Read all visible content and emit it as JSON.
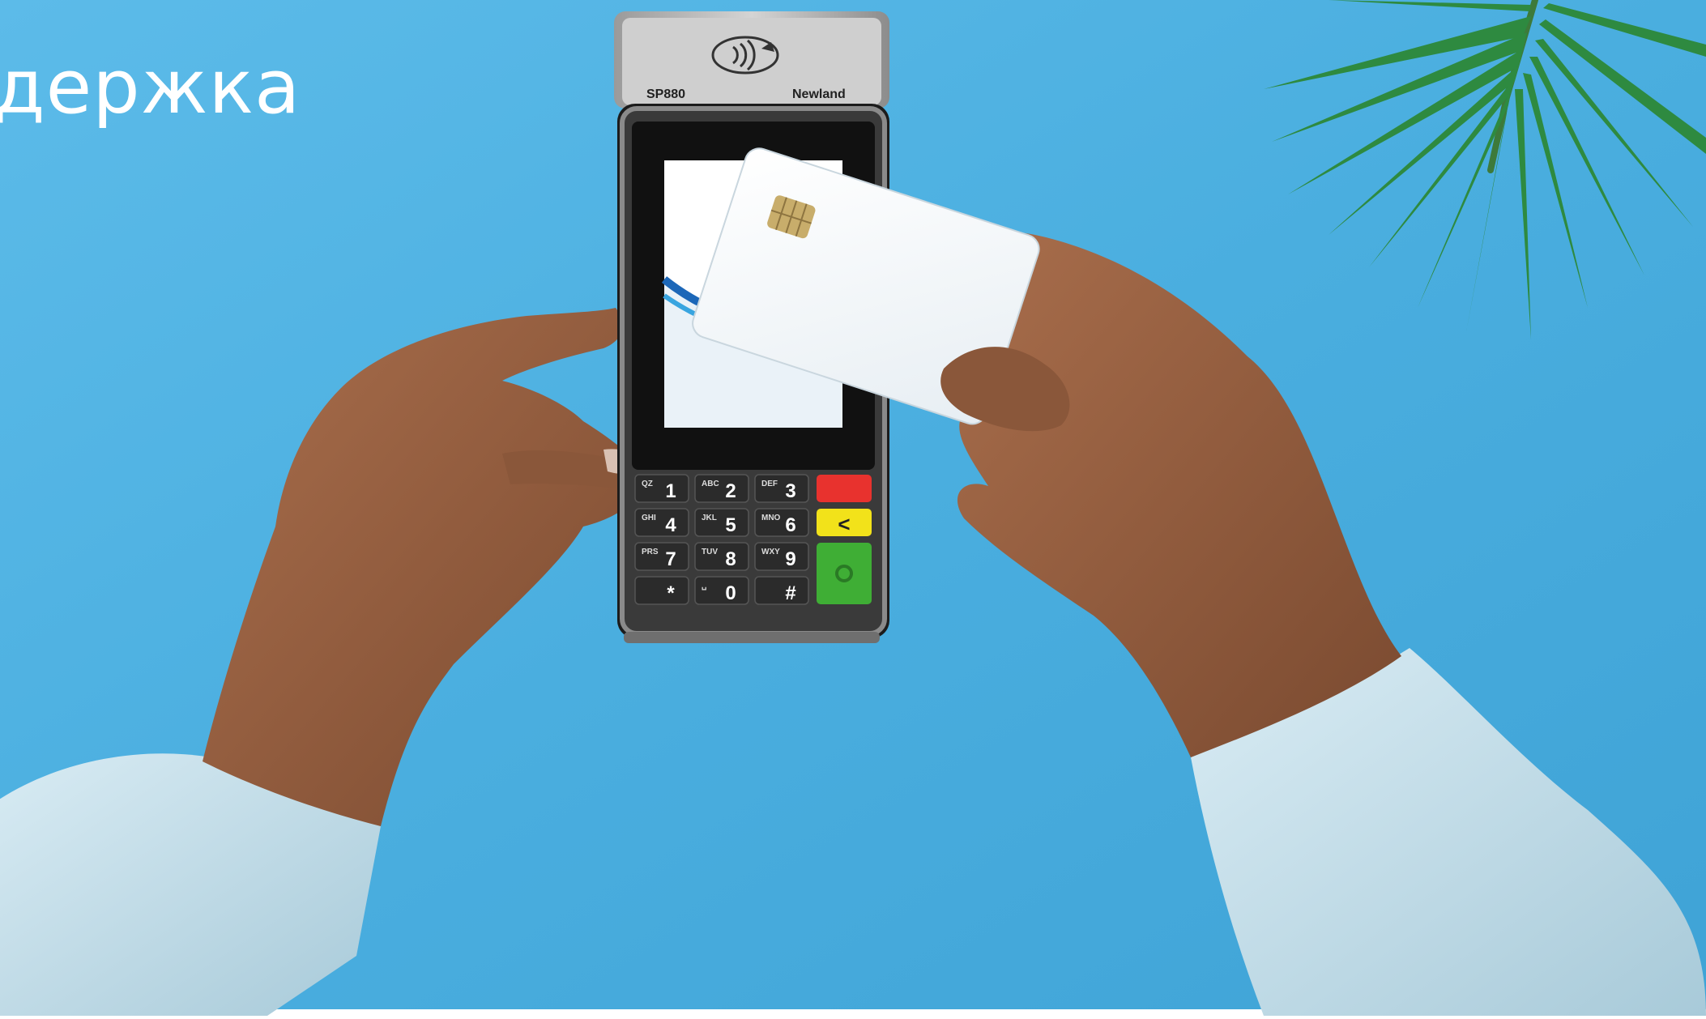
{
  "hero": {
    "title": "держка",
    "background_color": "#4fb0e0"
  },
  "terminal": {
    "model": "SP880",
    "brand": "Newland",
    "contactless_symbol": "contactless-payment-icon",
    "keys": [
      {
        "digit": "1",
        "letters": "QZ"
      },
      {
        "digit": "2",
        "letters": "ABC"
      },
      {
        "digit": "3",
        "letters": "DEF"
      },
      {
        "digit": "4",
        "letters": "GHI"
      },
      {
        "digit": "5",
        "letters": "JKL"
      },
      {
        "digit": "6",
        "letters": "MNO"
      },
      {
        "digit": "7",
        "letters": "PRS"
      },
      {
        "digit": "8",
        "letters": "TUV"
      },
      {
        "digit": "9",
        "letters": "WXY"
      },
      {
        "digit": "*",
        "letters": ""
      },
      {
        "digit": "0",
        "letters": "␣"
      },
      {
        "digit": "#",
        "letters": ""
      }
    ],
    "function_keys": {
      "cancel_color": "#e8322e",
      "back_color": "#f2e21a",
      "back_symbol": "<",
      "confirm_color": "#3fae35"
    }
  }
}
